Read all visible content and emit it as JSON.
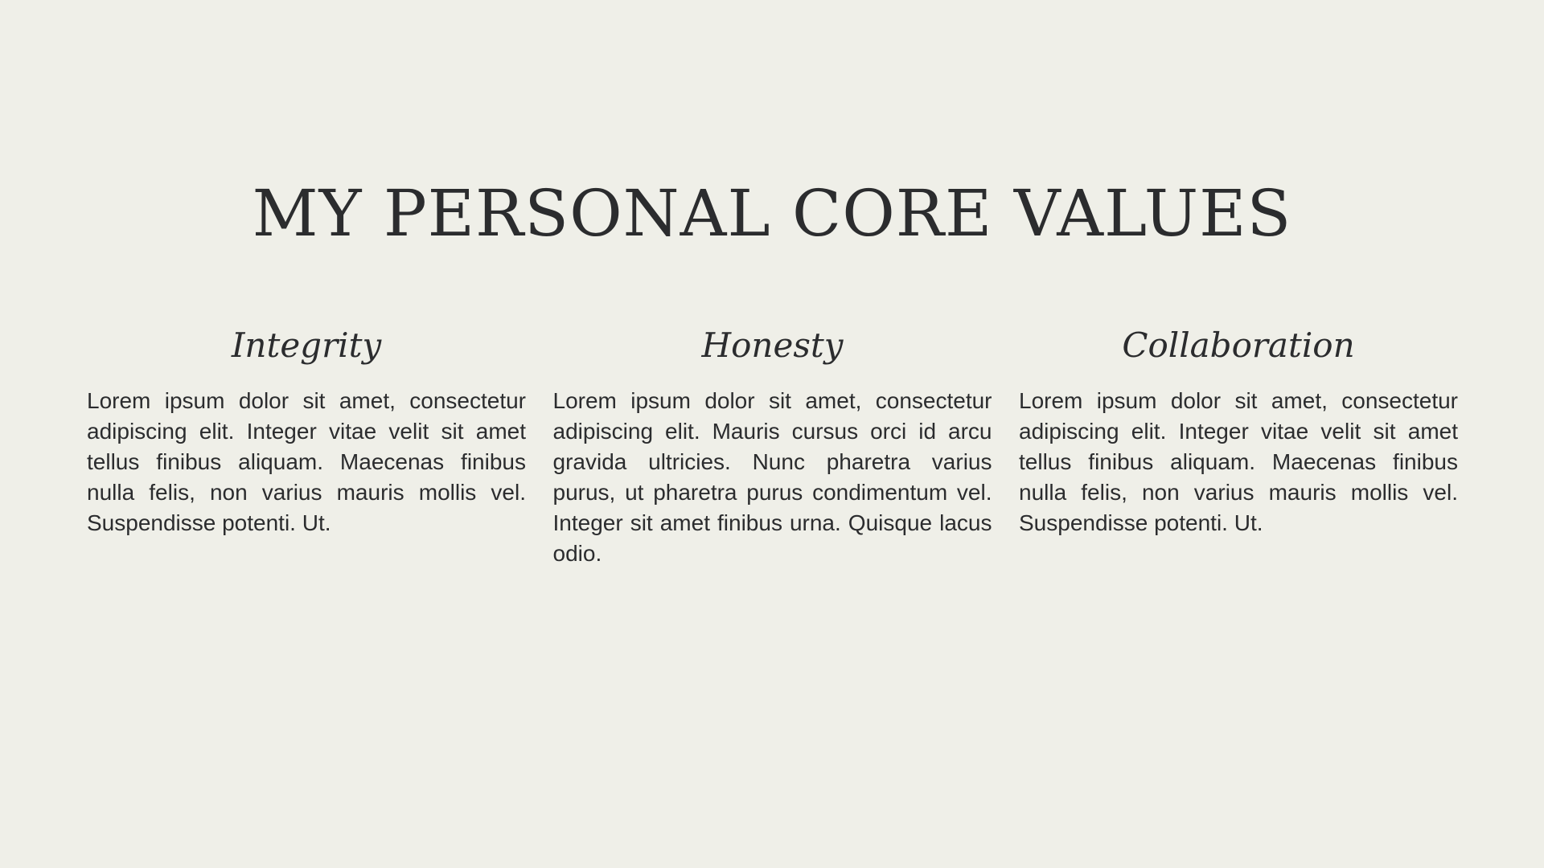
{
  "page": {
    "title": "MY PERSONAL CORE VALUES",
    "colors": {
      "background": "#efefe8",
      "text": "#2b2c2e"
    }
  },
  "values": [
    {
      "heading": "Integrity",
      "body": "Lorem ipsum dolor sit amet, consectetur adipiscing elit. Integer vitae velit sit amet tellus finibus aliquam. Maecenas finibus nulla felis, non varius mauris mollis vel. Suspendisse potenti. Ut."
    },
    {
      "heading": "Honesty",
      "body": "Lorem ipsum dolor sit amet, consectetur adipiscing elit. Mauris cursus orci id arcu gravida ultricies. Nunc pharetra varius purus, ut pharetra purus condimentum vel. Integer sit amet finibus urna. Quisque lacus odio."
    },
    {
      "heading": "Collaboration",
      "body": "Lorem ipsum dolor sit amet, consectetur adipiscing elit. Integer vitae velit sit amet tellus finibus aliquam. Maecenas finibus nulla felis, non varius mauris mollis vel. Suspendisse potenti. Ut."
    }
  ]
}
